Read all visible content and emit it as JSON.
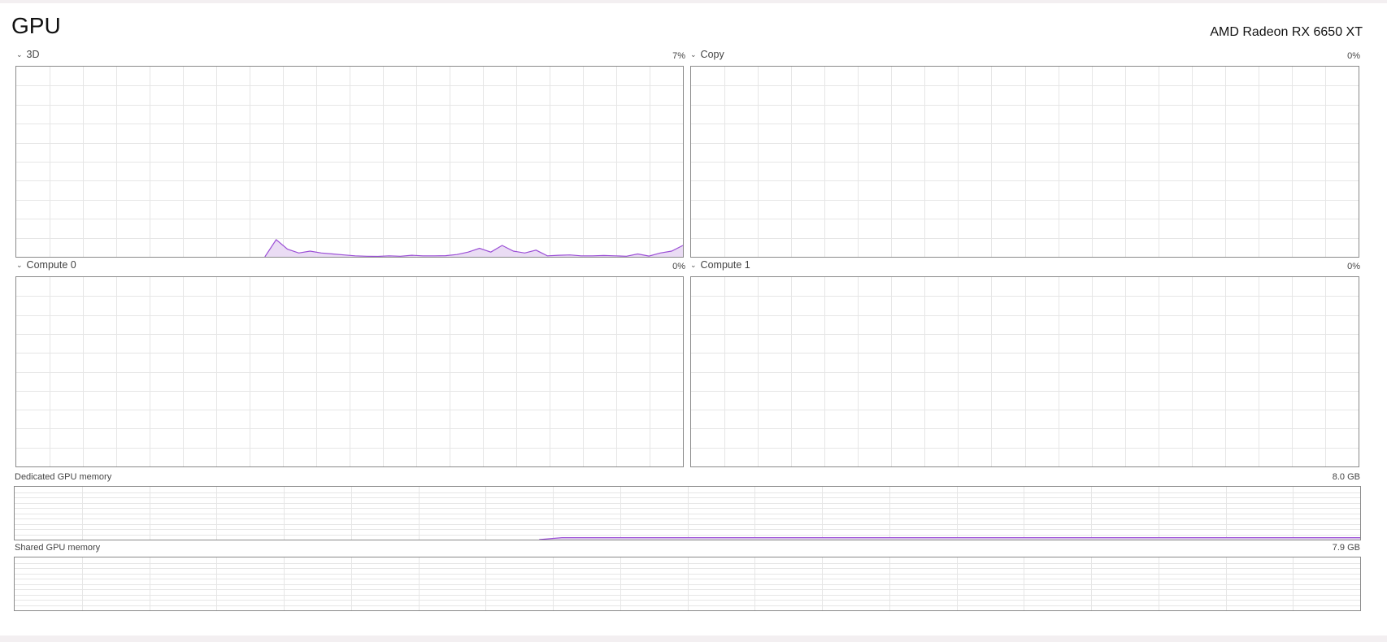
{
  "page": {
    "title": "GPU",
    "device_name": "AMD Radeon RX 6650 XT"
  },
  "colors": {
    "accent": "#9b4fd6",
    "fill": "#eadcf4",
    "grid": "#e6e6e6",
    "border": "#8a8a8a"
  },
  "engines": [
    {
      "label": "3D",
      "value": "7%",
      "chart_data": {
        "type": "area",
        "ylim": [
          0,
          100
        ],
        "x_points": 60,
        "values": [
          0,
          0,
          0,
          0,
          0,
          0,
          0,
          0,
          0,
          0,
          0,
          0,
          0,
          0,
          0,
          0,
          0,
          0,
          0,
          0,
          0,
          0,
          0,
          9,
          4,
          2,
          3,
          2,
          1.5,
          1,
          0.5,
          0.3,
          0.2,
          0.5,
          0.3,
          0.8,
          0.5,
          0.5,
          0.6,
          1.2,
          2.5,
          4.5,
          2.5,
          6,
          3,
          2,
          3.5,
          0.5,
          0.8,
          1,
          0.5,
          0.5,
          0.7,
          0.5,
          0.3,
          1.5,
          0.4,
          2,
          3,
          6
        ]
      }
    },
    {
      "label": "Copy",
      "value": "0%",
      "chart_data": {
        "type": "area",
        "ylim": [
          0,
          100
        ],
        "x_points": 60,
        "values": []
      }
    },
    {
      "label": "Compute 0",
      "value": "0%",
      "chart_data": {
        "type": "area",
        "ylim": [
          0,
          100
        ],
        "x_points": 60,
        "values": []
      }
    },
    {
      "label": "Compute 1",
      "value": "0%",
      "chart_data": {
        "type": "area",
        "ylim": [
          0,
          100
        ],
        "x_points": 60,
        "values": []
      }
    }
  ],
  "memory": [
    {
      "label": "Dedicated GPU memory",
      "value": "8.0 GB",
      "chart_data": {
        "type": "area",
        "ylim": [
          0,
          8.0
        ],
        "x_points": 60,
        "values": [
          0,
          0,
          0,
          0,
          0,
          0,
          0,
          0,
          0,
          0,
          0,
          0,
          0,
          0,
          0,
          0,
          0,
          0,
          0,
          0,
          0,
          0,
          0,
          0,
          0.3,
          0.3,
          0.3,
          0.3,
          0.3,
          0.3,
          0.3,
          0.3,
          0.3,
          0.3,
          0.3,
          0.3,
          0.3,
          0.3,
          0.3,
          0.3,
          0.3,
          0.3,
          0.3,
          0.3,
          0.3,
          0.3,
          0.3,
          0.3,
          0.3,
          0.3,
          0.3,
          0.3,
          0.3,
          0.3,
          0.3,
          0.3,
          0.3,
          0.3,
          0.3,
          0.3
        ]
      }
    },
    {
      "label": "Shared GPU memory",
      "value": "7.9 GB",
      "chart_data": {
        "type": "area",
        "ylim": [
          0,
          7.9
        ],
        "x_points": 60,
        "values": []
      }
    }
  ]
}
